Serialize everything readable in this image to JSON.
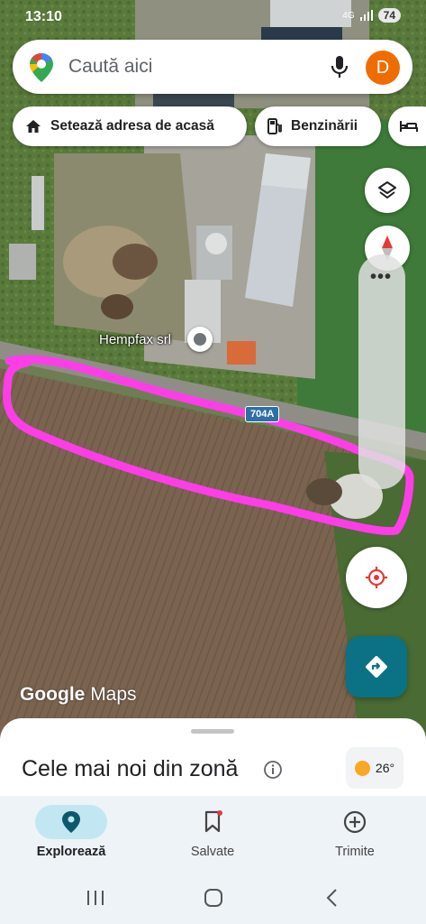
{
  "status": {
    "time": "13:10",
    "network": "4G",
    "battery": "74"
  },
  "search": {
    "placeholder": "Caută aici",
    "avatar_letter": "D"
  },
  "chips": [
    {
      "label": "Setează adresa de acasă",
      "icon": "home-icon"
    },
    {
      "label": "Benzinării",
      "icon": "gas-station-icon"
    },
    {
      "label": "",
      "icon": "hotel-bed-icon"
    }
  ],
  "map": {
    "place_name": "Hempfax srl",
    "road_shield": "704A",
    "logo_google": "Google",
    "logo_maps": "Maps",
    "annotation_color": "#ff3de8"
  },
  "controls": {
    "layers_icon": "layers-icon",
    "compass_icon": "compass-icon",
    "more_icon": "more-dots-icon",
    "location_icon": "my-location-icon",
    "directions_icon": "directions-icon",
    "directions_color": "#0b7285"
  },
  "sheet": {
    "title": "Cele mai noi din zonă",
    "temperature": "26°"
  },
  "bottom_nav": [
    {
      "label": "Explorează",
      "icon": "explore-pin-icon",
      "active": true
    },
    {
      "label": "Salvate",
      "icon": "bookmark-icon",
      "active": false
    },
    {
      "label": "Trimite",
      "icon": "add-circle-icon",
      "active": false
    }
  ]
}
